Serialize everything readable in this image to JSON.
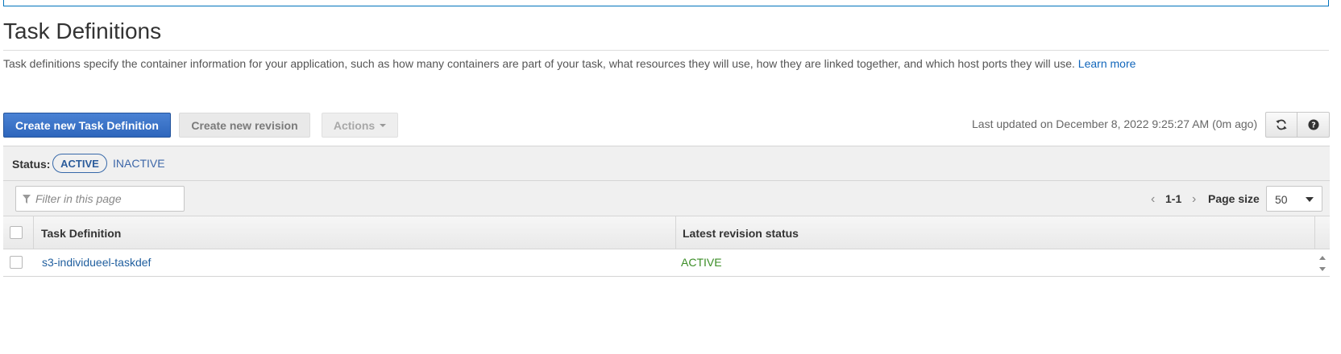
{
  "page": {
    "title": "Task Definitions",
    "description": "Task definitions specify the container information for your application, such as how many containers are part of your task, what resources they will use, how they are linked together, and which host ports they will use.",
    "learn_more": "Learn more"
  },
  "toolbar": {
    "create_label": "Create new Task Definition",
    "revision_label": "Create new revision",
    "actions_label": "Actions",
    "last_updated": "Last updated on December 8, 2022 9:25:27 AM (0m ago)",
    "refresh_icon": "refresh-icon",
    "help_icon": "help-icon"
  },
  "status_filter": {
    "label": "Status:",
    "active": "ACTIVE",
    "inactive": "INACTIVE"
  },
  "filter": {
    "placeholder": "Filter in this page",
    "value": ""
  },
  "pagination": {
    "range": "1-1",
    "page_size_label": "Page size",
    "page_size": "50"
  },
  "table": {
    "columns": [
      "Task Definition",
      "Latest revision status"
    ],
    "rows": [
      {
        "name": "s3-individueel-taskdef",
        "status": "ACTIVE"
      }
    ]
  },
  "colors": {
    "primary": "#3b73c9",
    "link": "#1f5e9e",
    "active_status": "#3b8d26"
  }
}
